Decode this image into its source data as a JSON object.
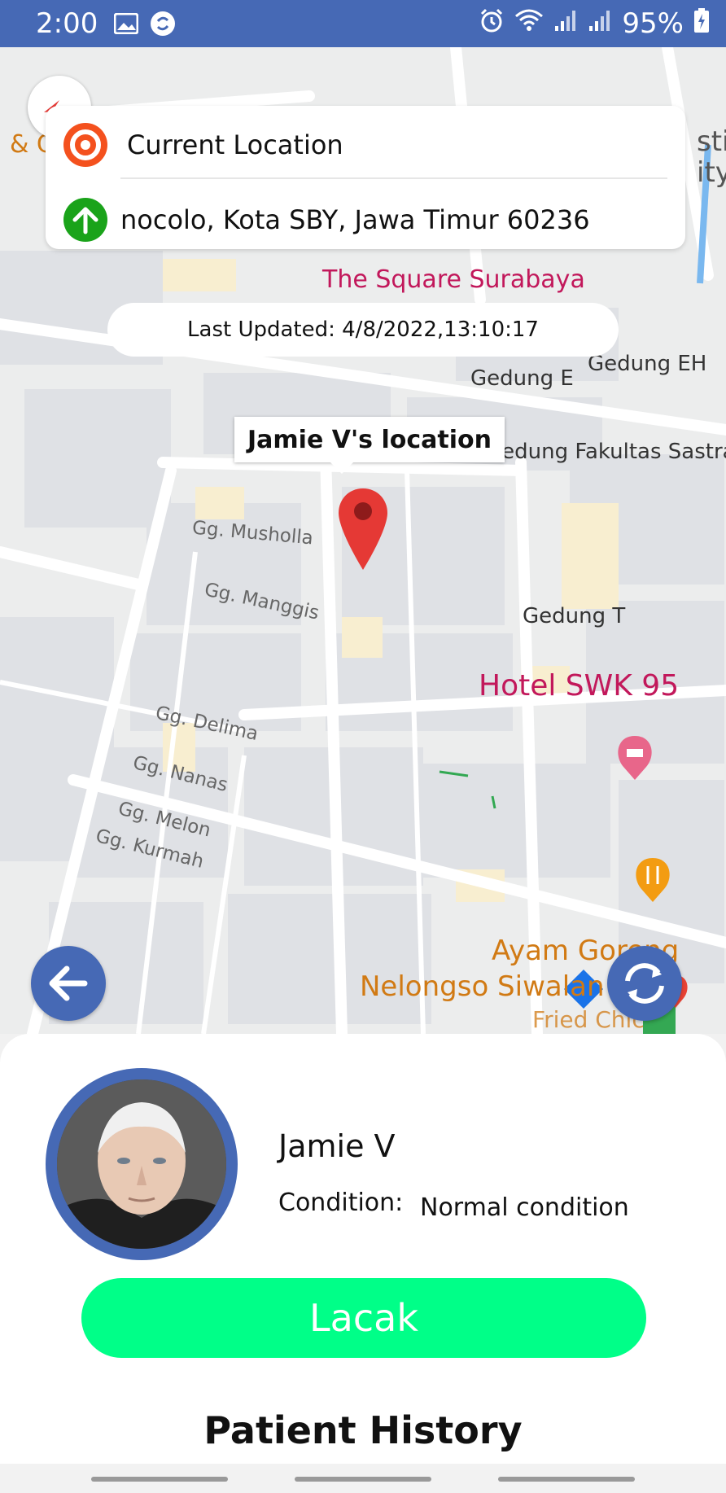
{
  "status_bar": {
    "time": "2:00",
    "battery": "95%",
    "icons": [
      "image-icon",
      "sync-app-icon",
      "alarm-icon",
      "wifi-icon",
      "signal-icon",
      "signal-icon",
      "battery-charging-icon"
    ]
  },
  "route": {
    "origin": "Current Location",
    "destination": "nocolo, Kota SBY, Jawa Timur 60236"
  },
  "map": {
    "last_updated": "Last Updated: 4/8/2022,13:10:17",
    "marker_title": "Jamie V's location",
    "labels": {
      "square": "The Square Surabaya",
      "gedung_e": "Gedung E",
      "gedung_eh": "Gedung EH",
      "fakultas": "Gedung Fakultas Sastra",
      "gedung_t": "Gedung T",
      "hotel": "Hotel SWK 95",
      "musholla": "Gg. Musholla",
      "manggis": "Gg. Manggis",
      "delima": "Gg. Delima",
      "nanas": "Gg. Nanas",
      "melon": "Gg. Melon",
      "kurmah": "Gg. Kurmah",
      "ayam1": "Ayam Goreng",
      "ayam2": "Nelongso Siwalan",
      "fried": "Fried Chic",
      "edge1": "& C",
      "edge2": "sti",
      "edge3": "ity"
    }
  },
  "patient": {
    "name": "Jamie V",
    "condition_label": "Condition:",
    "condition_value": "Normal condition"
  },
  "actions": {
    "track_label": "Lacak"
  },
  "section": {
    "history_title": "Patient History"
  },
  "colors": {
    "primary": "#4669b5",
    "track_button": "#00ff88",
    "origin_icon": "#f4511e",
    "destination_icon": "#1aa31a",
    "pin": "#e53935"
  }
}
